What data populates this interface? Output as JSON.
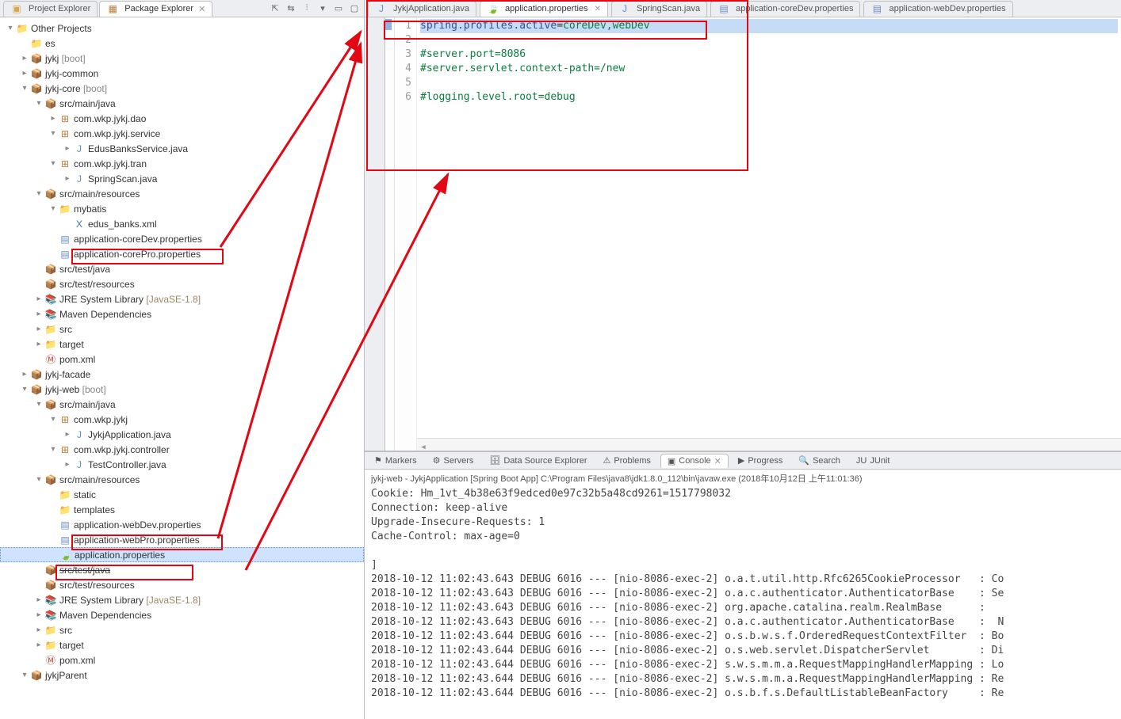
{
  "explorer": {
    "tabs": {
      "project": "Project Explorer",
      "package": "Package Explorer"
    },
    "tree": [
      {
        "d": 0,
        "tw": "▾",
        "ic": "folder",
        "t": "Other Projects"
      },
      {
        "d": 1,
        "tw": "",
        "ic": "folder",
        "t": "es"
      },
      {
        "d": 1,
        "tw": "▸",
        "ic": "jar",
        "t": "jykj",
        "decor": " [boot]"
      },
      {
        "d": 1,
        "tw": "▸",
        "ic": "jar",
        "t": "jykj-common"
      },
      {
        "d": 1,
        "tw": "▾",
        "ic": "jar",
        "t": "jykj-core",
        "decor": " [boot]"
      },
      {
        "d": 2,
        "tw": "▾",
        "ic": "jar",
        "t": "src/main/java"
      },
      {
        "d": 3,
        "tw": "▸",
        "ic": "pkg",
        "t": "com.wkp.jykj.dao"
      },
      {
        "d": 3,
        "tw": "▾",
        "ic": "pkg",
        "t": "com.wkp.jykj.service"
      },
      {
        "d": 4,
        "tw": "▸",
        "ic": "java",
        "t": "EdusBanksService.java"
      },
      {
        "d": 3,
        "tw": "▾",
        "ic": "pkg",
        "t": "com.wkp.jykj.tran"
      },
      {
        "d": 4,
        "tw": "▸",
        "ic": "java",
        "t": "SpringScan.java"
      },
      {
        "d": 2,
        "tw": "▾",
        "ic": "jar",
        "t": "src/main/resources"
      },
      {
        "d": 3,
        "tw": "▾",
        "ic": "folder",
        "t": "mybatis"
      },
      {
        "d": 4,
        "tw": "",
        "ic": "xml",
        "t": "edus_banks.xml"
      },
      {
        "d": 3,
        "tw": "",
        "ic": "file",
        "t": "application-coreDev.properties",
        "box": true
      },
      {
        "d": 3,
        "tw": "",
        "ic": "file",
        "t": "application-corePro.properties"
      },
      {
        "d": 2,
        "tw": "",
        "ic": "jar",
        "t": "src/test/java"
      },
      {
        "d": 2,
        "tw": "",
        "ic": "jar",
        "t": "src/test/resources"
      },
      {
        "d": 2,
        "tw": "▸",
        "ic": "lib",
        "t": "JRE System Library",
        "jre": " [JavaSE-1.8]"
      },
      {
        "d": 2,
        "tw": "▸",
        "ic": "lib",
        "t": "Maven Dependencies"
      },
      {
        "d": 2,
        "tw": "▸",
        "ic": "folder",
        "t": "src"
      },
      {
        "d": 2,
        "tw": "▸",
        "ic": "folder",
        "t": "target"
      },
      {
        "d": 2,
        "tw": "",
        "ic": "maven",
        "t": "pom.xml"
      },
      {
        "d": 1,
        "tw": "▸",
        "ic": "jar",
        "t": "jykj-facade"
      },
      {
        "d": 1,
        "tw": "▾",
        "ic": "jar",
        "t": "jykj-web",
        "decor": " [boot]"
      },
      {
        "d": 2,
        "tw": "▾",
        "ic": "jar",
        "t": "src/main/java"
      },
      {
        "d": 3,
        "tw": "▾",
        "ic": "pkg",
        "t": "com.wkp.jykj"
      },
      {
        "d": 4,
        "tw": "▸",
        "ic": "java",
        "t": "JykjApplication.java"
      },
      {
        "d": 3,
        "tw": "▾",
        "ic": "pkg",
        "t": "com.wkp.jykj.controller"
      },
      {
        "d": 4,
        "tw": "▸",
        "ic": "java",
        "t": "TestController.java"
      },
      {
        "d": 2,
        "tw": "▾",
        "ic": "jar",
        "t": "src/main/resources"
      },
      {
        "d": 3,
        "tw": "",
        "ic": "folder",
        "t": "static"
      },
      {
        "d": 3,
        "tw": "",
        "ic": "folder",
        "t": "templates"
      },
      {
        "d": 3,
        "tw": "",
        "ic": "file",
        "t": "application-webDev.properties",
        "box": true
      },
      {
        "d": 3,
        "tw": "",
        "ic": "file",
        "t": "application-webPro.properties"
      },
      {
        "d": 3,
        "tw": "",
        "ic": "spring",
        "t": "application.properties",
        "sel": true,
        "box": true,
        "wide": true
      },
      {
        "d": 2,
        "tw": "",
        "ic": "jar",
        "t": "src/test/java",
        "strike": true
      },
      {
        "d": 2,
        "tw": "",
        "ic": "jar",
        "t": "src/test/resources"
      },
      {
        "d": 2,
        "tw": "▸",
        "ic": "lib",
        "t": "JRE System Library",
        "jre": " [JavaSE-1.8]"
      },
      {
        "d": 2,
        "tw": "▸",
        "ic": "lib",
        "t": "Maven Dependencies"
      },
      {
        "d": 2,
        "tw": "▸",
        "ic": "folder",
        "t": "src"
      },
      {
        "d": 2,
        "tw": "▸",
        "ic": "folder",
        "t": "target"
      },
      {
        "d": 2,
        "tw": "",
        "ic": "maven",
        "t": "pom.xml"
      },
      {
        "d": 1,
        "tw": "▾",
        "ic": "jar",
        "t": "jykjParent"
      }
    ]
  },
  "editor": {
    "tabs": [
      {
        "label": "JykjApplication.java",
        "icon": "java"
      },
      {
        "label": "application.properties",
        "icon": "spring",
        "active": true,
        "close": true
      },
      {
        "label": "SpringScan.java",
        "icon": "java"
      },
      {
        "label": "application-coreDev.properties",
        "icon": "file"
      },
      {
        "label": "application-webDev.properties",
        "icon": "file"
      }
    ],
    "lines": [
      {
        "k": "spring.profiles.active",
        "eq": "=",
        "v": "coreDev,webDev",
        "hl": true
      },
      {},
      {
        "c": "#server.port=8086"
      },
      {
        "c": "#server.servlet.context-path=/new"
      },
      {},
      {
        "c": "#logging.level.root=debug"
      }
    ]
  },
  "views": {
    "tabs": [
      "Markers",
      "Servers",
      "Data Source Explorer",
      "Problems",
      "Console",
      "Progress",
      "Search",
      "JUnit"
    ],
    "active": 4,
    "consoleHeader": "jykj-web - JykjApplication [Spring Boot App] C:\\Program Files\\java8\\jdk1.8.0_112\\bin\\javaw.exe (2018年10月12日 上午11:01:36)",
    "consoleLines": [
      "Cookie: Hm_1vt_4b38e63f9edced0e97c32b5a48cd9261=1517798032",
      "Connection: keep-alive",
      "Upgrade-Insecure-Requests: 1",
      "Cache-Control: max-age=0",
      "",
      "]",
      "2018-10-12 11:02:43.643 DEBUG 6016 --- [nio-8086-exec-2] o.a.t.util.http.Rfc6265CookieProcessor   : Co",
      "2018-10-12 11:02:43.643 DEBUG 6016 --- [nio-8086-exec-2] o.a.c.authenticator.AuthenticatorBase    : Se",
      "2018-10-12 11:02:43.643 DEBUG 6016 --- [nio-8086-exec-2] org.apache.catalina.realm.RealmBase      :  ",
      "2018-10-12 11:02:43.643 DEBUG 6016 --- [nio-8086-exec-2] o.a.c.authenticator.AuthenticatorBase    :  N",
      "2018-10-12 11:02:43.644 DEBUG 6016 --- [nio-8086-exec-2] o.s.b.w.s.f.OrderedRequestContextFilter  : Bo",
      "2018-10-12 11:02:43.644 DEBUG 6016 --- [nio-8086-exec-2] o.s.web.servlet.DispatcherServlet        : Di",
      "2018-10-12 11:02:43.644 DEBUG 6016 --- [nio-8086-exec-2] s.w.s.m.m.a.RequestMappingHandlerMapping : Lo",
      "2018-10-12 11:02:43.644 DEBUG 6016 --- [nio-8086-exec-2] s.w.s.m.m.a.RequestMappingHandlerMapping : Re",
      "2018-10-12 11:02:43.644 DEBUG 6016 --- [nio-8086-exec-2] o.s.b.f.s.DefaultListableBeanFactory     : Re"
    ]
  }
}
